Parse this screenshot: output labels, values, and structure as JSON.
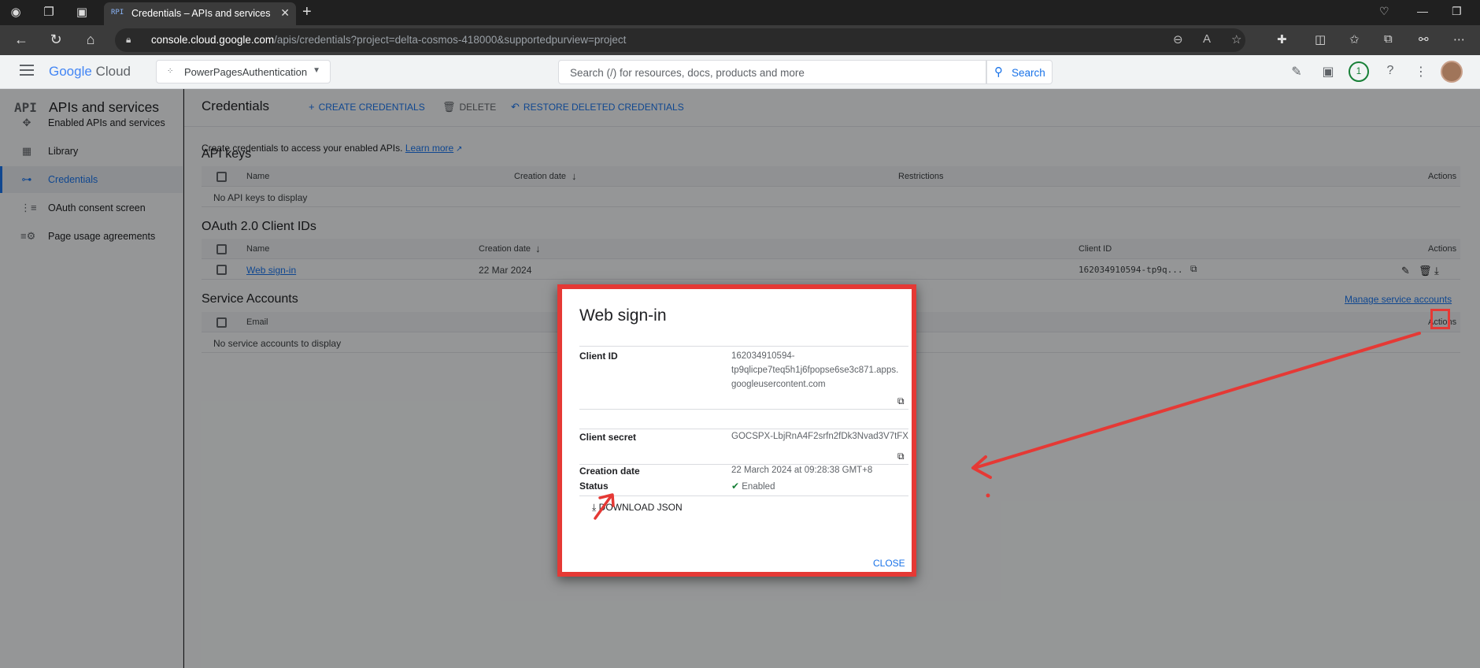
{
  "browser": {
    "tab_title": "Credentials – APIs and services –",
    "tab_favicon": "RPI",
    "url_host": "console.cloud.google.com",
    "url_path": "/apis/credentials?project=delta-cosmos-418000&supportedpurview=project"
  },
  "header": {
    "logo_google": "Google",
    "logo_cloud": "Cloud",
    "project_name": "PowerPagesAuthentication",
    "search_placeholder": "Search (/) for resources, docs, products and more",
    "search_button": "Search",
    "notifications_count": "1"
  },
  "sidebar": {
    "icon_text": "API",
    "title": "APIs and services",
    "items": [
      {
        "label": "Enabled APIs and services",
        "icon": "diamond-arrows-icon",
        "glyph": "✥"
      },
      {
        "label": "Library",
        "icon": "library-grid-icon",
        "glyph": "▦"
      },
      {
        "label": "Credentials",
        "icon": "key-icon",
        "glyph": "⊶"
      },
      {
        "label": "OAuth consent screen",
        "icon": "consent-icon",
        "glyph": "⋮≡"
      },
      {
        "label": "Page usage agreements",
        "icon": "settings-list-icon",
        "glyph": "≡⚙"
      }
    ]
  },
  "main": {
    "title": "Credentials",
    "create_label": "CREATE CREDENTIALS",
    "delete_label": "DELETE",
    "restore_label": "RESTORE DELETED CREDENTIALS",
    "intro_text": "Create credentials to access your enabled APIs.",
    "learn_more": "Learn more",
    "api_keys": {
      "title": "API keys",
      "col_name": "Name",
      "col_creation": "Creation date",
      "col_restrictions": "Restrictions",
      "col_actions": "Actions",
      "empty": "No API keys to display"
    },
    "oauth": {
      "title": "OAuth 2.0 Client IDs",
      "col_name": "Name",
      "col_creation": "Creation date",
      "col_client_id": "Client ID",
      "col_actions": "Actions",
      "row_name": "Web sign-in",
      "row_date": "22 Mar 2024",
      "row_client_id": "162034910594-tp9q..."
    },
    "service_accounts": {
      "title": "Service Accounts",
      "manage_link": "Manage service accounts",
      "col_email": "Email",
      "col_actions": "Actions",
      "empty": "No service accounts to display"
    }
  },
  "modal": {
    "title": "Web sign-in",
    "client_id_label": "Client ID",
    "client_id_line1": "162034910594-",
    "client_id_line2": "tp9qlicpe7teq5h1j6fpopse6se3c871.apps.",
    "client_id_line3": "googleusercontent.com",
    "client_secret_label": "Client secret",
    "client_secret_value": "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",
    "creation_label": "Creation date",
    "creation_value": "22 March 2024 at 09:28:38 GMT+8",
    "status_label": "Status",
    "status_value": "Enabled",
    "download_label": "DOWNLOAD JSON",
    "close_label": "CLOSE"
  },
  "colors": {
    "accent": "#1a73e8",
    "annotation_red": "#e53935",
    "enabled_green": "#188038"
  }
}
